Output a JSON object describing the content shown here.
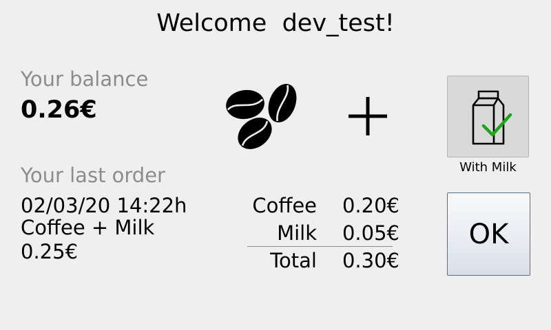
{
  "header": {
    "welcome_prefix": "Welcome",
    "username": "dev_test",
    "suffix": "!"
  },
  "balance": {
    "label": "Your balance",
    "value": "0.26€"
  },
  "last_order": {
    "label": "Your last order",
    "datetime": "02/03/20 14:22h",
    "items": "Coffee + Milk",
    "price": "0.25€"
  },
  "icons": {
    "coffee": "coffee-beans-icon",
    "plus": "plus-icon",
    "milk": "milk-carton-icon",
    "check": "checkmark-icon"
  },
  "milk_toggle": {
    "label": "With Milk",
    "selected": true,
    "check_color": "#1aa51a"
  },
  "receipt": {
    "rows": [
      {
        "name": "Coffee",
        "price": "0.20€"
      },
      {
        "name": "Milk",
        "price": "0.05€"
      }
    ],
    "total": {
      "name": "Total",
      "price": "0.30€"
    }
  },
  "ok_button": {
    "label": "OK",
    "border_color": "#4a6f9a"
  }
}
